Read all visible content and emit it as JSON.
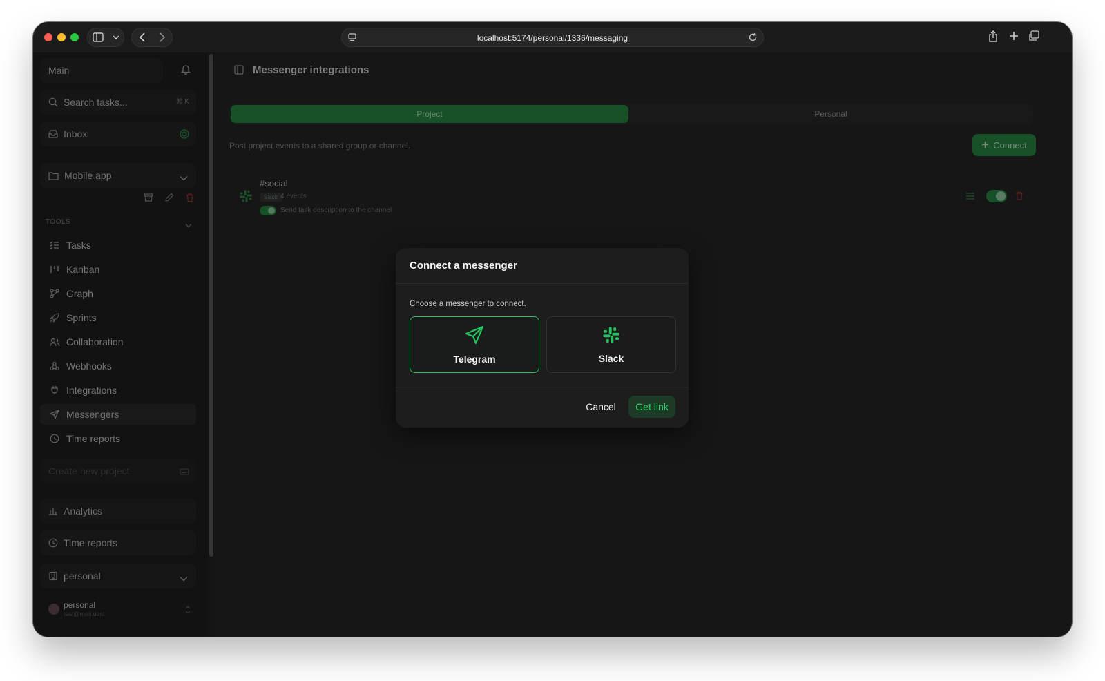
{
  "browser": {
    "url": "localhost:5174/personal/1336/messaging"
  },
  "sidebar": {
    "workspace": "Main",
    "search": {
      "placeholder": "Search tasks...",
      "shortcut": "⌘ K"
    },
    "inbox": "Inbox",
    "project": "Mobile app",
    "tools_heading": "TOOLS",
    "tools": [
      {
        "label": "Tasks",
        "icon": "list-checks-icon"
      },
      {
        "label": "Kanban",
        "icon": "kanban-icon"
      },
      {
        "label": "Graph",
        "icon": "graph-icon"
      },
      {
        "label": "Sprints",
        "icon": "rocket-icon"
      },
      {
        "label": "Collaboration",
        "icon": "users-icon"
      },
      {
        "label": "Webhooks",
        "icon": "webhook-icon"
      },
      {
        "label": "Integrations",
        "icon": "plug-icon"
      },
      {
        "label": "Messengers",
        "icon": "send-icon"
      },
      {
        "label": "Time reports",
        "icon": "clock-icon"
      }
    ],
    "create_project": "Create new project",
    "analytics": "Analytics",
    "time_reports": "Time reports",
    "org": "personal",
    "user": {
      "name": "personal",
      "email": "test@mail.dest"
    }
  },
  "main": {
    "title": "Messenger integrations",
    "tabs": [
      "Project",
      "Personal"
    ],
    "description": "Post project events to a shared group or channel.",
    "connect_label": "Connect",
    "channel": {
      "name": "#social",
      "badge": "Slack",
      "events": "4 events",
      "toggle_text": "Send task description to the channel"
    }
  },
  "dialog": {
    "title": "Connect a messenger",
    "description": "Choose a messenger to connect.",
    "options": [
      {
        "label": "Telegram",
        "icon": "telegram-send-icon",
        "selected": true
      },
      {
        "label": "Slack",
        "icon": "slack-icon",
        "selected": false
      }
    ],
    "cancel": "Cancel",
    "confirm": "Get link"
  },
  "colors": {
    "accent": "#25c35f",
    "accent_dark": "#2a8a45",
    "danger": "#c0392b"
  }
}
